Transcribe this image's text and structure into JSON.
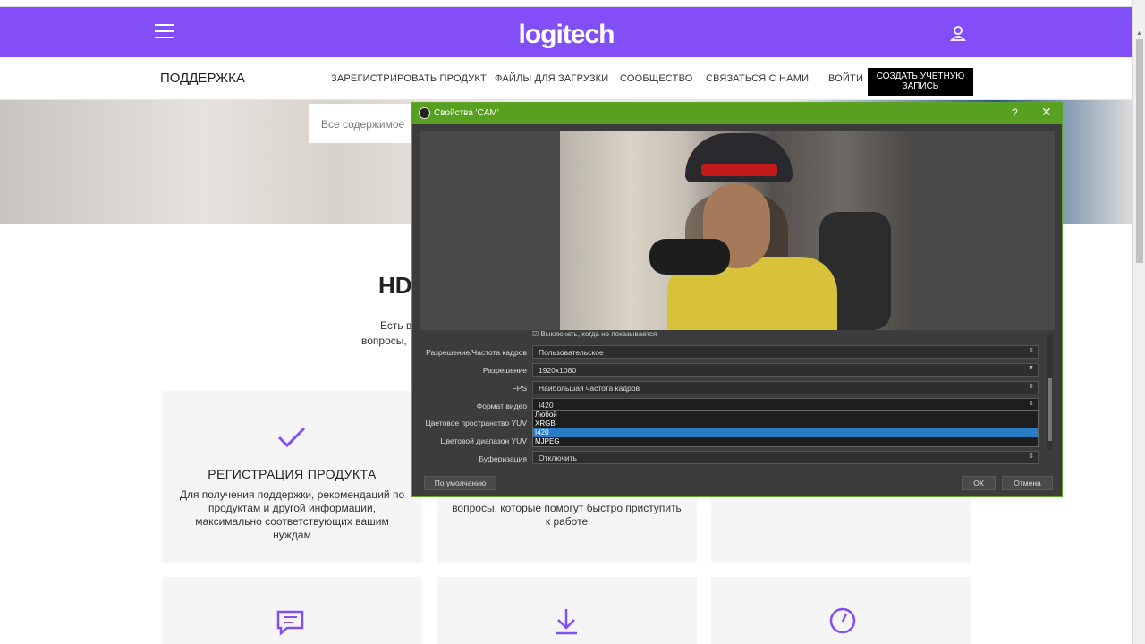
{
  "header": {
    "logo": "logitech"
  },
  "nav": {
    "support": "ПОДДЕРЖКА",
    "links": [
      "ЗАРЕГИСТРИРОВАТЬ ПРОДУКТ",
      "ФАЙЛЫ ДЛЯ ЗАГРУЗКИ",
      "СООБЩЕСТВО",
      "СВЯЗАТЬСЯ С НАМИ",
      "ВОЙТИ"
    ],
    "cta_line1": "СОЗДАТЬ УЧЕТНУЮ",
    "cta_line2": "ЗАПИСЬ"
  },
  "hero": {
    "search_placeholder": "Все содержимое"
  },
  "main": {
    "heading": "HD",
    "intro_line1": "Есть в",
    "intro_line2": "вопросы,"
  },
  "cards": [
    {
      "title": "РЕГИСТРАЦИЯ ПРОДУКТА",
      "desc_lines": [
        "Для получения поддержки, рекомендаций по",
        "продуктам и другой информации,",
        "максимально соответствующих вашим",
        "нуждам"
      ]
    },
    {
      "title": "",
      "desc_lines": [
        "вопросы, которые помогут быстро приступить",
        "к работе"
      ]
    }
  ],
  "dialog": {
    "title": "Свойства 'CAM'",
    "help": "?",
    "close": "✕",
    "checkbox_label": "Выключать, когда не показывается",
    "labels": {
      "resolution_fps_type": "Разрешение/Частота кадров",
      "resolution": "Разрешение",
      "fps": "FPS",
      "video_format": "Формат видео",
      "yuv_space": "Цветовое пространство YUV",
      "yuv_range": "Цветовой диапазон YUV",
      "buffering": "Буферизация"
    },
    "values": {
      "resolution_fps_type": "Пользовательское",
      "resolution": "1920x1080",
      "fps": "Наибольшая частота кадров",
      "video_format": "I420",
      "buffering": "Отключить"
    },
    "format_options": [
      "Любой",
      "XRGB",
      "I420",
      "MJPEG"
    ],
    "selected_format": "I420",
    "buttons": {
      "defaults": "По умолчанию",
      "ok": "ОК",
      "cancel": "Отмена"
    }
  },
  "colors": {
    "brand_purple": "#814ef7",
    "obs_green": "#58a01f",
    "selection_blue": "#2a7cc7"
  }
}
